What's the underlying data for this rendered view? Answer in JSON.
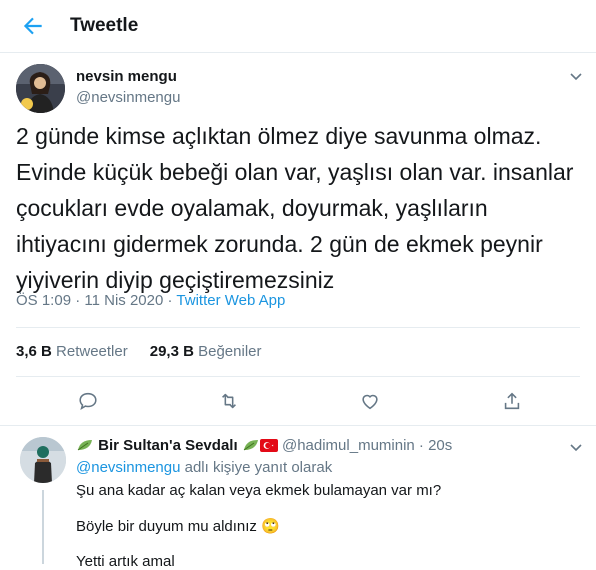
{
  "header": {
    "title": "Tweetle"
  },
  "tweet": {
    "author_name": "nevsin mengu",
    "author_handle": "@nevsinmengu",
    "text": "2 günde kimse açlıktan ölmez diye savunma olmaz. Evinde küçük bebeği olan var, yaşlısı olan var. insanlar çocukları evde oyalamak, doyurmak, yaşlıların ihtiyacını gidermek zorunda. 2 gün de ekmek peynir yiyiverin diyip geçiştiremezsiniz",
    "time": "ÖS 1:09",
    "sep1": " · ",
    "date": "11 Nis 2020",
    "sep2": " · ",
    "app": "Twitter Web App",
    "retweets_count": "3,6 B",
    "retweets_label": "Retweetler",
    "likes_count": "29,3 B",
    "likes_label": "Beğeniler"
  },
  "reply": {
    "name": "Bir Sultan'a Sevdalı",
    "handle": "@hadimul_muminin",
    "sep": " · ",
    "time": "20s",
    "replying_prefix": "",
    "mention": "@nevsinmengu",
    "replying_suffix": " adlı kişiye yanıt olarak",
    "line1": "Şu ana kadar aç kalan veya ekmek bulamayan var mı?",
    "line2": "Böyle bir duyum mu aldınız 🙄",
    "line3": "Yetti artık amal"
  },
  "icons": [
    "back-arrow-icon",
    "chevron-down-icon",
    "reply-icon",
    "retweet-icon",
    "like-icon",
    "share-icon",
    "leaf-icon",
    "turkey-flag-icon"
  ],
  "colors": {
    "accent": "#1da1f2",
    "link": "#1b95e0",
    "muted": "#657786",
    "border": "#e6ecf0"
  }
}
